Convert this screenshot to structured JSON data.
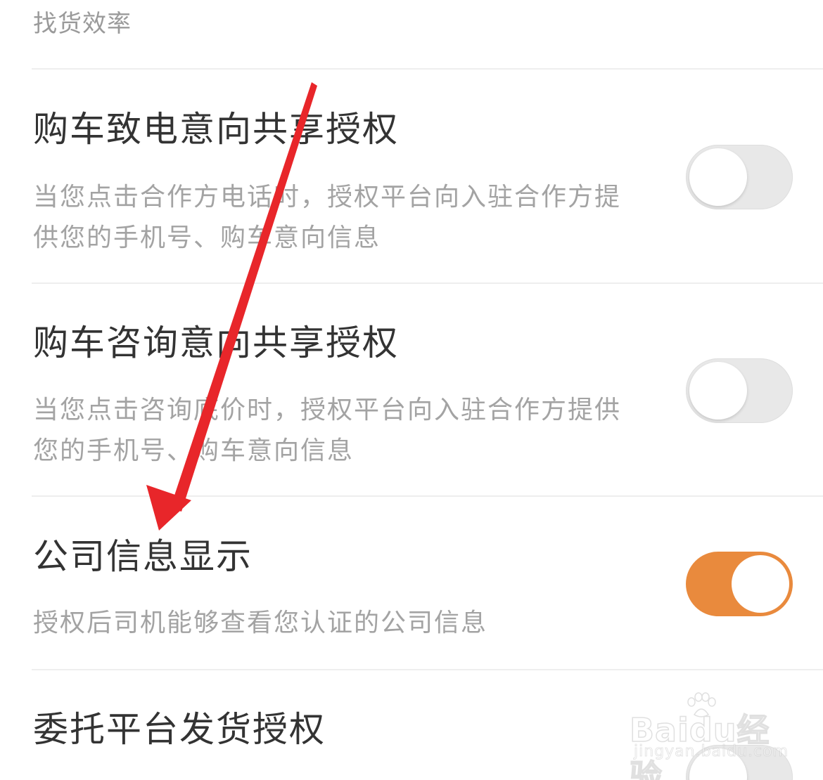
{
  "prev_item": {
    "desc_tail": "找货效率"
  },
  "settings": [
    {
      "title": "购车致电意向共享授权",
      "desc_line1": "当您点击合作方电话时，授权平台向入驻合作方提",
      "desc_line2": "供您的手机号、购车意向信息",
      "enabled": false
    },
    {
      "title": "购车咨询意向共享授权",
      "desc_line1": "当您点击咨询底价时，授权平台向入驻合作方提供",
      "desc_line2": "您的手机号、购车意向信息",
      "enabled": false
    },
    {
      "title": "公司信息显示",
      "desc_line1": "授权后司机能够查看您认证的公司信息",
      "enabled": true
    },
    {
      "title": "委托平台发货授权",
      "enabled": false
    }
  ],
  "colors": {
    "toggle_on": "#e98a3d",
    "toggle_off": "#e8e8e8",
    "annotation_arrow": "#e8262a"
  },
  "watermark": {
    "brand": "Baidu经验",
    "url": "jingyan.baidu.com"
  },
  "annotation": {
    "icon": "arrow-down-left-icon"
  }
}
